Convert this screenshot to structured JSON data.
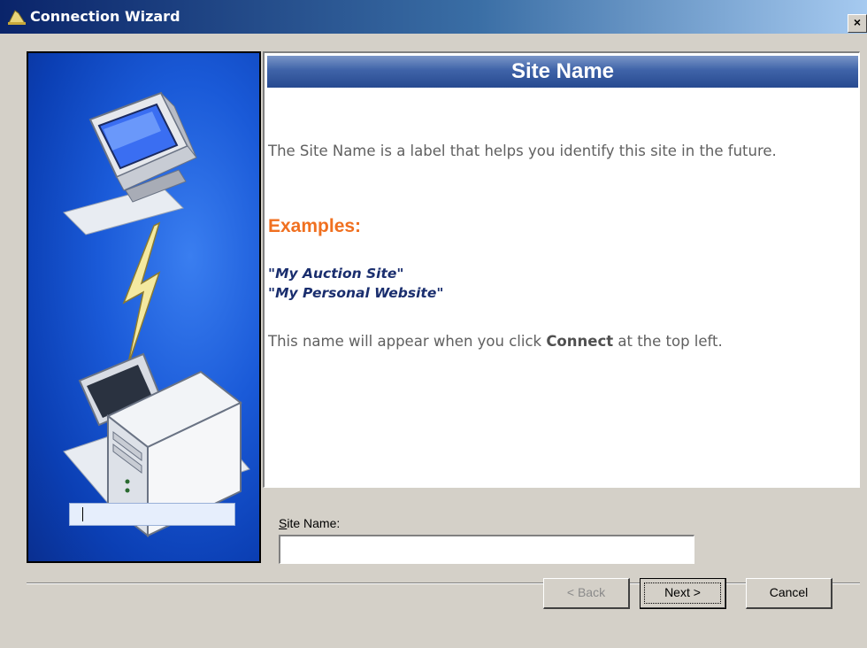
{
  "window": {
    "title": "Connection Wizard",
    "close_glyph": "×"
  },
  "header": {
    "title": "Site Name"
  },
  "body": {
    "description": "The Site Name is a label that helps you identify this site in the future.",
    "examples_heading": "Examples:",
    "examples": [
      "\"My Auction Site\"",
      "\"My Personal Website\""
    ],
    "note_prefix": "This name will appear when you click ",
    "note_bold": "Connect",
    "note_suffix": " at the top left."
  },
  "field": {
    "label_accel": "S",
    "label_rest": "ite Name:",
    "value": ""
  },
  "buttons": {
    "back": "< Back",
    "next": "Next >",
    "cancel": "Cancel"
  },
  "colors": {
    "title_bar": "#0a246a",
    "panel_blue": "#1a5ad8",
    "examples_heading": "#f07020",
    "examples_text": "#1a2e6e"
  },
  "icons": {
    "title_icon": "wizard-hat-icon",
    "close_icon": "close-icon",
    "computer": "computer-monitor-icon",
    "server": "server-tower-icon",
    "link": "lightning-connection-icon"
  }
}
